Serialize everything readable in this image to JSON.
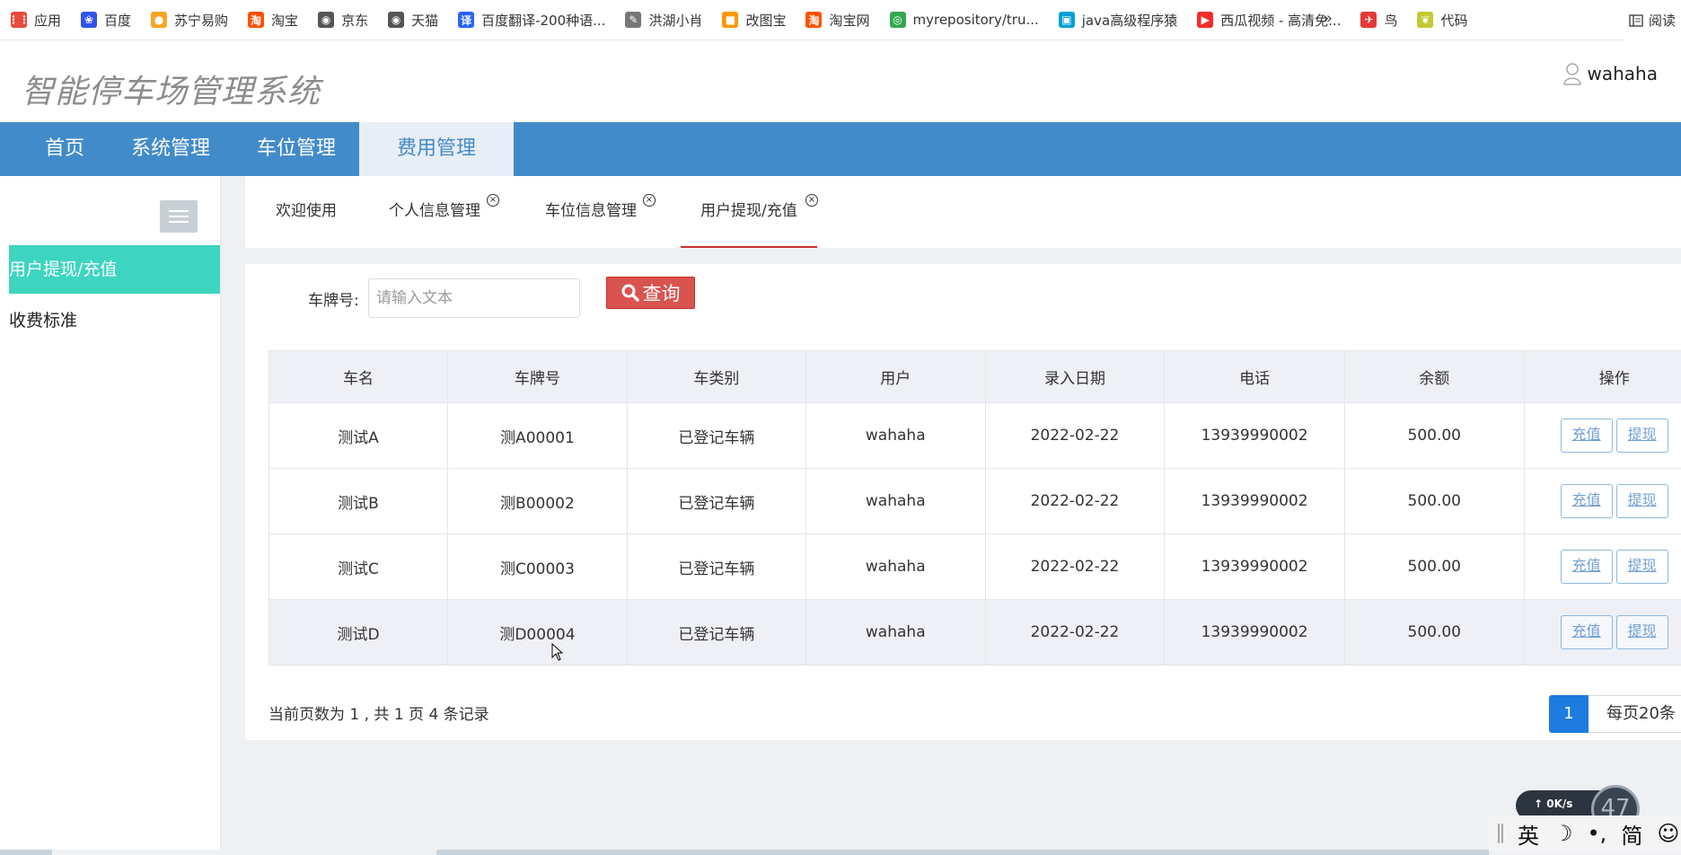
{
  "bookmarks": [
    {
      "label": "应用",
      "icon": "apps-grid-icon",
      "color": "#e74c3c"
    },
    {
      "label": "百度",
      "icon": "baidu-paw-icon",
      "color": "#2f54eb"
    },
    {
      "label": "苏宁易购",
      "icon": "suning-lion-icon",
      "color": "#f5a623"
    },
    {
      "label": "淘宝",
      "icon": "taobao-icon",
      "color": "#ff5000"
    },
    {
      "label": "京东",
      "icon": "globe-icon",
      "color": "#555555"
    },
    {
      "label": "天猫",
      "icon": "globe-icon",
      "color": "#555555"
    },
    {
      "label": "百度翻译-200种语...",
      "icon": "translate-icon",
      "color": "#2962ff"
    },
    {
      "label": "洪湖小肖",
      "icon": "feather-icon",
      "color": "#777777"
    },
    {
      "label": "改图宝",
      "icon": "folder-icon",
      "color": "#ff9800"
    },
    {
      "label": "淘宝网",
      "icon": "taobao-icon",
      "color": "#ff5000"
    },
    {
      "label": "myrepository/tru...",
      "icon": "chrome-icon",
      "color": "#34a853"
    },
    {
      "label": "java高级程序猿",
      "icon": "bilibili-icon",
      "color": "#00a1d6"
    },
    {
      "label": "西瓜视频 - 高清免...",
      "icon": "xigua-icon",
      "color": "#f52c2c"
    },
    {
      "label": "鸟",
      "icon": "bird-icon",
      "color": "#e53935"
    },
    {
      "label": "代码",
      "icon": "leaf-icon",
      "color": "#c0ca33"
    }
  ],
  "bookmarks_more": "»",
  "reading_list": "阅读",
  "header": {
    "app_title": "智能停车场管理系统",
    "username": "wahaha"
  },
  "topnav": [
    "首页",
    "系统管理",
    "车位管理",
    "费用管理"
  ],
  "sidebar": [
    "用户提现/充值",
    "收费标准"
  ],
  "tabs": [
    {
      "label": "欢迎使用",
      "closable": false
    },
    {
      "label": "个人信息管理",
      "closable": true
    },
    {
      "label": "车位信息管理",
      "closable": true
    },
    {
      "label": "用户提现/充值",
      "closable": true
    }
  ],
  "search": {
    "label": "车牌号:",
    "placeholder": "请输入文本",
    "button": "查询"
  },
  "table": {
    "headers": [
      "车名",
      "车牌号",
      "车类别",
      "用户",
      "录入日期",
      "电话",
      "余额",
      "操作"
    ],
    "rows": [
      [
        "测试A",
        "测A00001",
        "已登记车辆",
        "wahaha",
        "2022-02-22",
        "13939990002",
        "500.00"
      ],
      [
        "测试B",
        "测B00002",
        "已登记车辆",
        "wahaha",
        "2022-02-22",
        "13939990002",
        "500.00"
      ],
      [
        "测试C",
        "测C00003",
        "已登记车辆",
        "wahaha",
        "2022-02-22",
        "13939990002",
        "500.00"
      ],
      [
        "测试D",
        "测D00004",
        "已登记车辆",
        "wahaha",
        "2022-02-22",
        "13939990002",
        "500.00"
      ]
    ],
    "actions": [
      "充值",
      "提现"
    ]
  },
  "pagination": {
    "info": "当前页数为 1 , 共 1 页  4 条记录",
    "current": "1",
    "page_size": "每页20条"
  },
  "speed_widget": {
    "rate": "0K/s",
    "value": "47"
  },
  "ime": [
    "英",
    "☽",
    "•,",
    "简",
    "☺"
  ],
  "colors": {
    "nav": "#428bca",
    "sidebar_active": "#3dd5c0",
    "search_button": "#d9534f",
    "pager_active": "#1e7be0"
  }
}
